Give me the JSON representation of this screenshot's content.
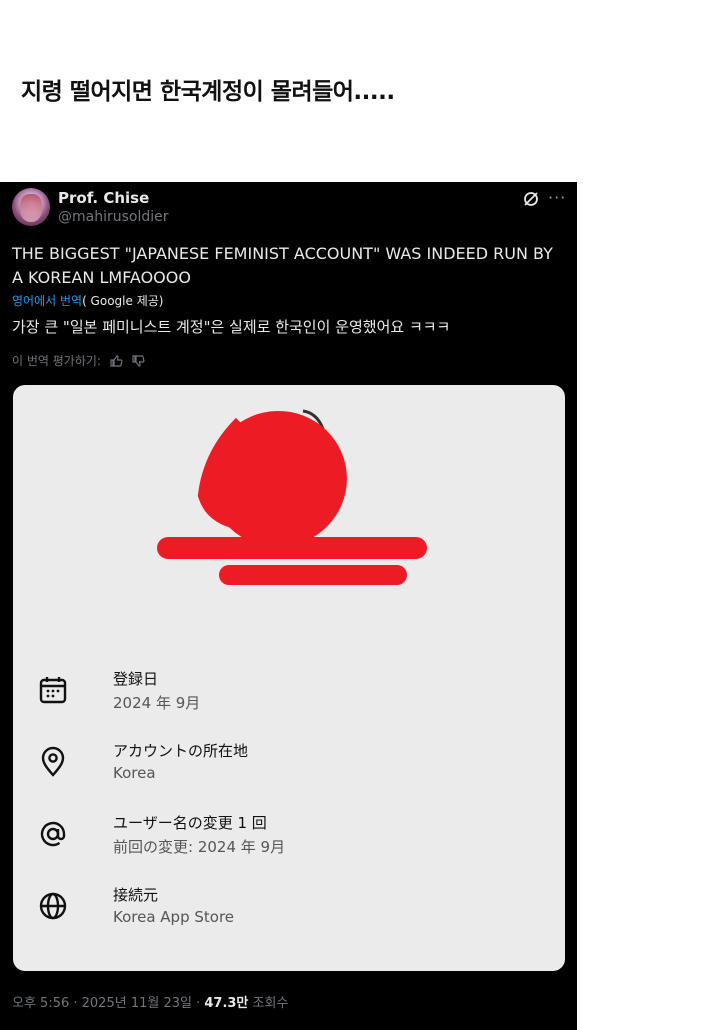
{
  "post_title": "지령 떨어지면 한국계정이 몰려들어.....",
  "tweet": {
    "display_name": "Prof. Chise",
    "handle": "@mahirusoldier",
    "text_en": "THE BIGGEST \"JAPANESE FEMINIST ACCOUNT\" WAS INDEED RUN BY A KOREAN LMFAOOOO",
    "translate_link": "영어에서 번역",
    "translate_provider": "( Google 제공)",
    "text_ko": "가장 큰 \"일본 페미니스트 계정\"은 실제로 한국인이 운영했어요 ㅋㅋㅋ",
    "rate_translation": "이 번역 평가하기:",
    "meta_time_date": "오후 5:56 · 2025년 11월 23일 · ",
    "meta_views": "47.3만",
    "meta_views_label": " 조회수"
  },
  "about_account": {
    "rows": [
      {
        "icon": "calendar-icon",
        "title": "登録日",
        "value": "2024 年 9月"
      },
      {
        "icon": "location-pin-icon",
        "title": "アカウントの所在地",
        "value": "Korea"
      },
      {
        "icon": "at-sign-icon",
        "title": "ユーザー名の変更 1 回",
        "value": "前回の変更: 2024 年 9月"
      },
      {
        "icon": "globe-icon",
        "title": "接続元",
        "value": "Korea App Store"
      }
    ]
  },
  "colors": {
    "tweet_bg": "#000000",
    "card_bg": "#ebebeb",
    "redaction_red": "#ec1c24",
    "link_blue": "#1d9bf0",
    "muted": "#71767b"
  }
}
